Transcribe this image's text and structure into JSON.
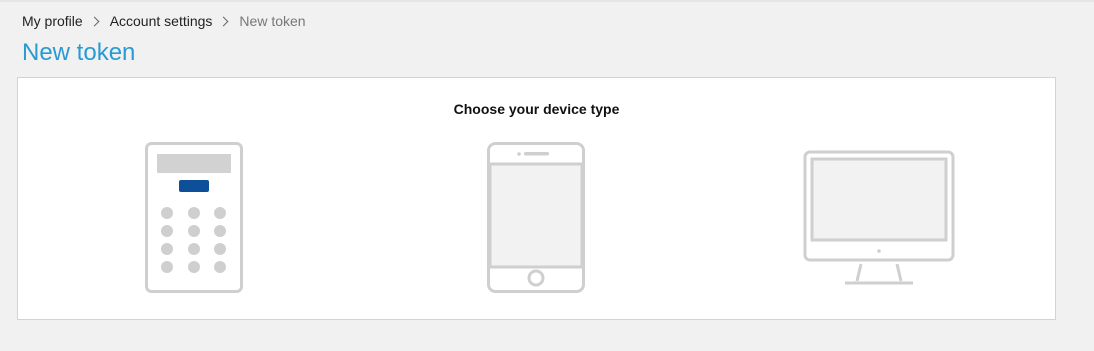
{
  "breadcrumb": {
    "items": [
      "My profile",
      "Account settings"
    ],
    "current": "New token"
  },
  "page": {
    "title": "New token"
  },
  "chooser": {
    "heading": "Choose your device type",
    "devices": [
      {
        "icon": "hardware-token-icon"
      },
      {
        "icon": "smartphone-icon"
      },
      {
        "icon": "desktop-computer-icon"
      }
    ]
  },
  "colors": {
    "accent": "#2a9ad2",
    "icon_stroke": "#cfcfcf",
    "token_button": "#0d4f99",
    "background": "#f1f1f1"
  }
}
